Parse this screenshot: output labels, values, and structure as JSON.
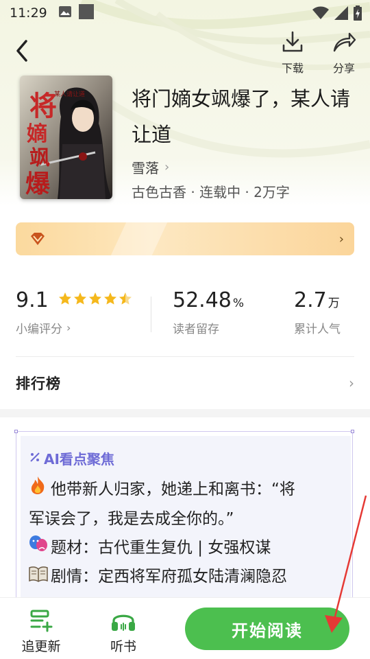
{
  "status_bar": {
    "time": "11:29"
  },
  "top_actions": {
    "download_label": "下载",
    "share_label": "分享"
  },
  "book": {
    "title": "将门嫡女飒爆了，某人请让道",
    "author": "雪落",
    "meta": "古色古香 · 连载中 · 2万字",
    "cover_title": "将门嫡女飒爆了",
    "cover_subtitle": "某人请让道"
  },
  "stats": {
    "rating": {
      "value": "9.1",
      "label": "小编评分",
      "stars": 4.5
    },
    "retention": {
      "value": "52.48",
      "unit": "%",
      "label": "读者留存"
    },
    "popularity": {
      "value": "2.7",
      "unit": "万",
      "label": "累计人气"
    }
  },
  "ranking": {
    "label": "排行榜"
  },
  "ai_focus": {
    "title": "AI看点聚焦",
    "lines": [
      {
        "icon": "fire-icon",
        "text": "他带新人归家，她递上和离书：“将"
      },
      {
        "icon": "",
        "text": "军误会了，我是去成全你的。”"
      },
      {
        "icon": "theater-masks-icon",
        "text": "题材：古代重生复仇 | 女强权谋"
      },
      {
        "icon": "book-icon",
        "text": "剧情：定西将军府孤女陆清澜隐忍"
      }
    ]
  },
  "bottom_bar": {
    "follow_label": "追更新",
    "listen_label": "听书",
    "read_label": "开始阅读"
  },
  "colors": {
    "accent_green": "#4cbf4f",
    "banner_gold": "#fbd99e",
    "ai_purple": "#6e6bd6",
    "annotation_red": "#e53935"
  }
}
